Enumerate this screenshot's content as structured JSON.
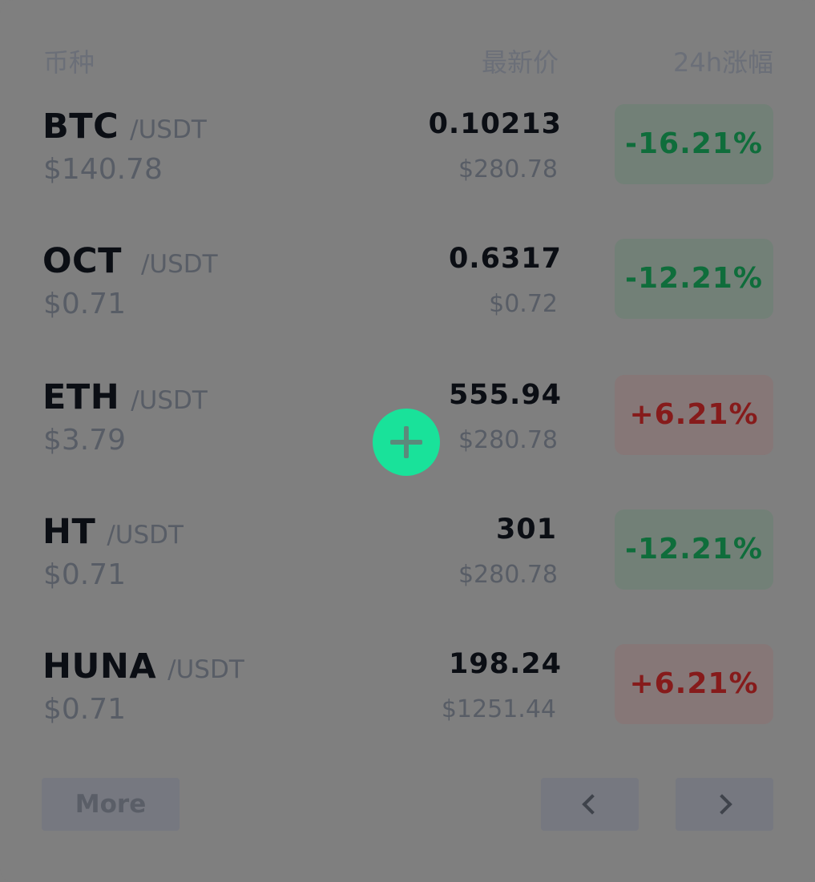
{
  "header": {
    "coin_label": "币种",
    "price_label": "最新价",
    "change_label": "24h涨幅"
  },
  "rows": [
    {
      "symbol": "BTC",
      "quote": "/USDT",
      "usd_value": "$140.78",
      "last_price": "0.10213",
      "last_price_usd": "$280.78",
      "change": "-16.21%",
      "direction": "down"
    },
    {
      "symbol": "OCT",
      "quote": "/USDT",
      "usd_value": "$0.71",
      "last_price": "0.6317",
      "last_price_usd": "$0.72",
      "change": "-12.21%",
      "direction": "down"
    },
    {
      "symbol": "ETH",
      "quote": "/USDT",
      "usd_value": "$3.79",
      "last_price": "555.94",
      "last_price_usd": "$280.78",
      "change": "+6.21%",
      "direction": "up"
    },
    {
      "symbol": "HT",
      "quote": "/USDT",
      "usd_value": "$0.71",
      "last_price": "301",
      "last_price_usd": "$280.78",
      "change": "-12.21%",
      "direction": "down"
    },
    {
      "symbol": "HUNA",
      "quote": "/USDT",
      "usd_value": "$0.71",
      "last_price": "198.24",
      "last_price_usd": "$1251.44",
      "change": "+6.21%",
      "direction": "up"
    }
  ],
  "footer": {
    "more_label": "More",
    "prev_icon": "chevron-left-icon",
    "next_icon": "chevron-right-icon"
  },
  "fab": {
    "icon": "plus-icon",
    "color": "#19e29a"
  },
  "colors": {
    "down_text": "#0f6d3b",
    "up_text": "#861b1b",
    "overlay": "#7f7f7f"
  }
}
